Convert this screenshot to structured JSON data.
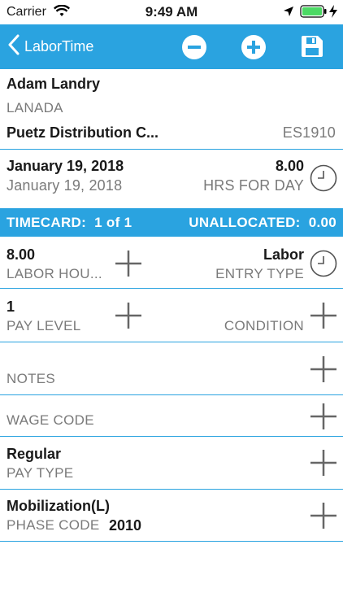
{
  "status_bar": {
    "carrier": "Carrier",
    "time": "9:49 AM",
    "icons": [
      "wifi-icon",
      "location-arrow-icon",
      "battery-icon",
      "charging-bolt-icon"
    ]
  },
  "nav": {
    "back_label": "LaborTime",
    "buttons": [
      "minus-circle-icon",
      "plus-circle-icon",
      "save-disk-icon"
    ],
    "accent": "#2aa3e0"
  },
  "employee": {
    "name": "Adam Landry",
    "code": "LANADA",
    "company": "Puetz Distribution C...",
    "company_id": "ES1910"
  },
  "date": {
    "date": "January 19, 2018",
    "date_sub": "January 19, 2018",
    "hours": "8.00",
    "hours_label": "HRS FOR DAY"
  },
  "timecard": {
    "label": "TIMECARD:",
    "index": "1 of 1",
    "unallocated_label": "UNALLOCATED:",
    "unallocated_value": "0.00"
  },
  "labor": {
    "hours": "8.00",
    "hours_label": "LABOR HOU...",
    "entry_type": "Labor",
    "entry_type_label": "ENTRY TYPE"
  },
  "pay_level": {
    "value": "1",
    "label": "PAY LEVEL",
    "condition_label": "CONDITION"
  },
  "notes": {
    "label": "NOTES"
  },
  "wage_code": {
    "label": "WAGE CODE"
  },
  "pay_type": {
    "value": "Regular",
    "label": "PAY TYPE"
  },
  "phase": {
    "value": "Mobilization(L)",
    "label": "PHASE CODE",
    "code": "2010"
  }
}
